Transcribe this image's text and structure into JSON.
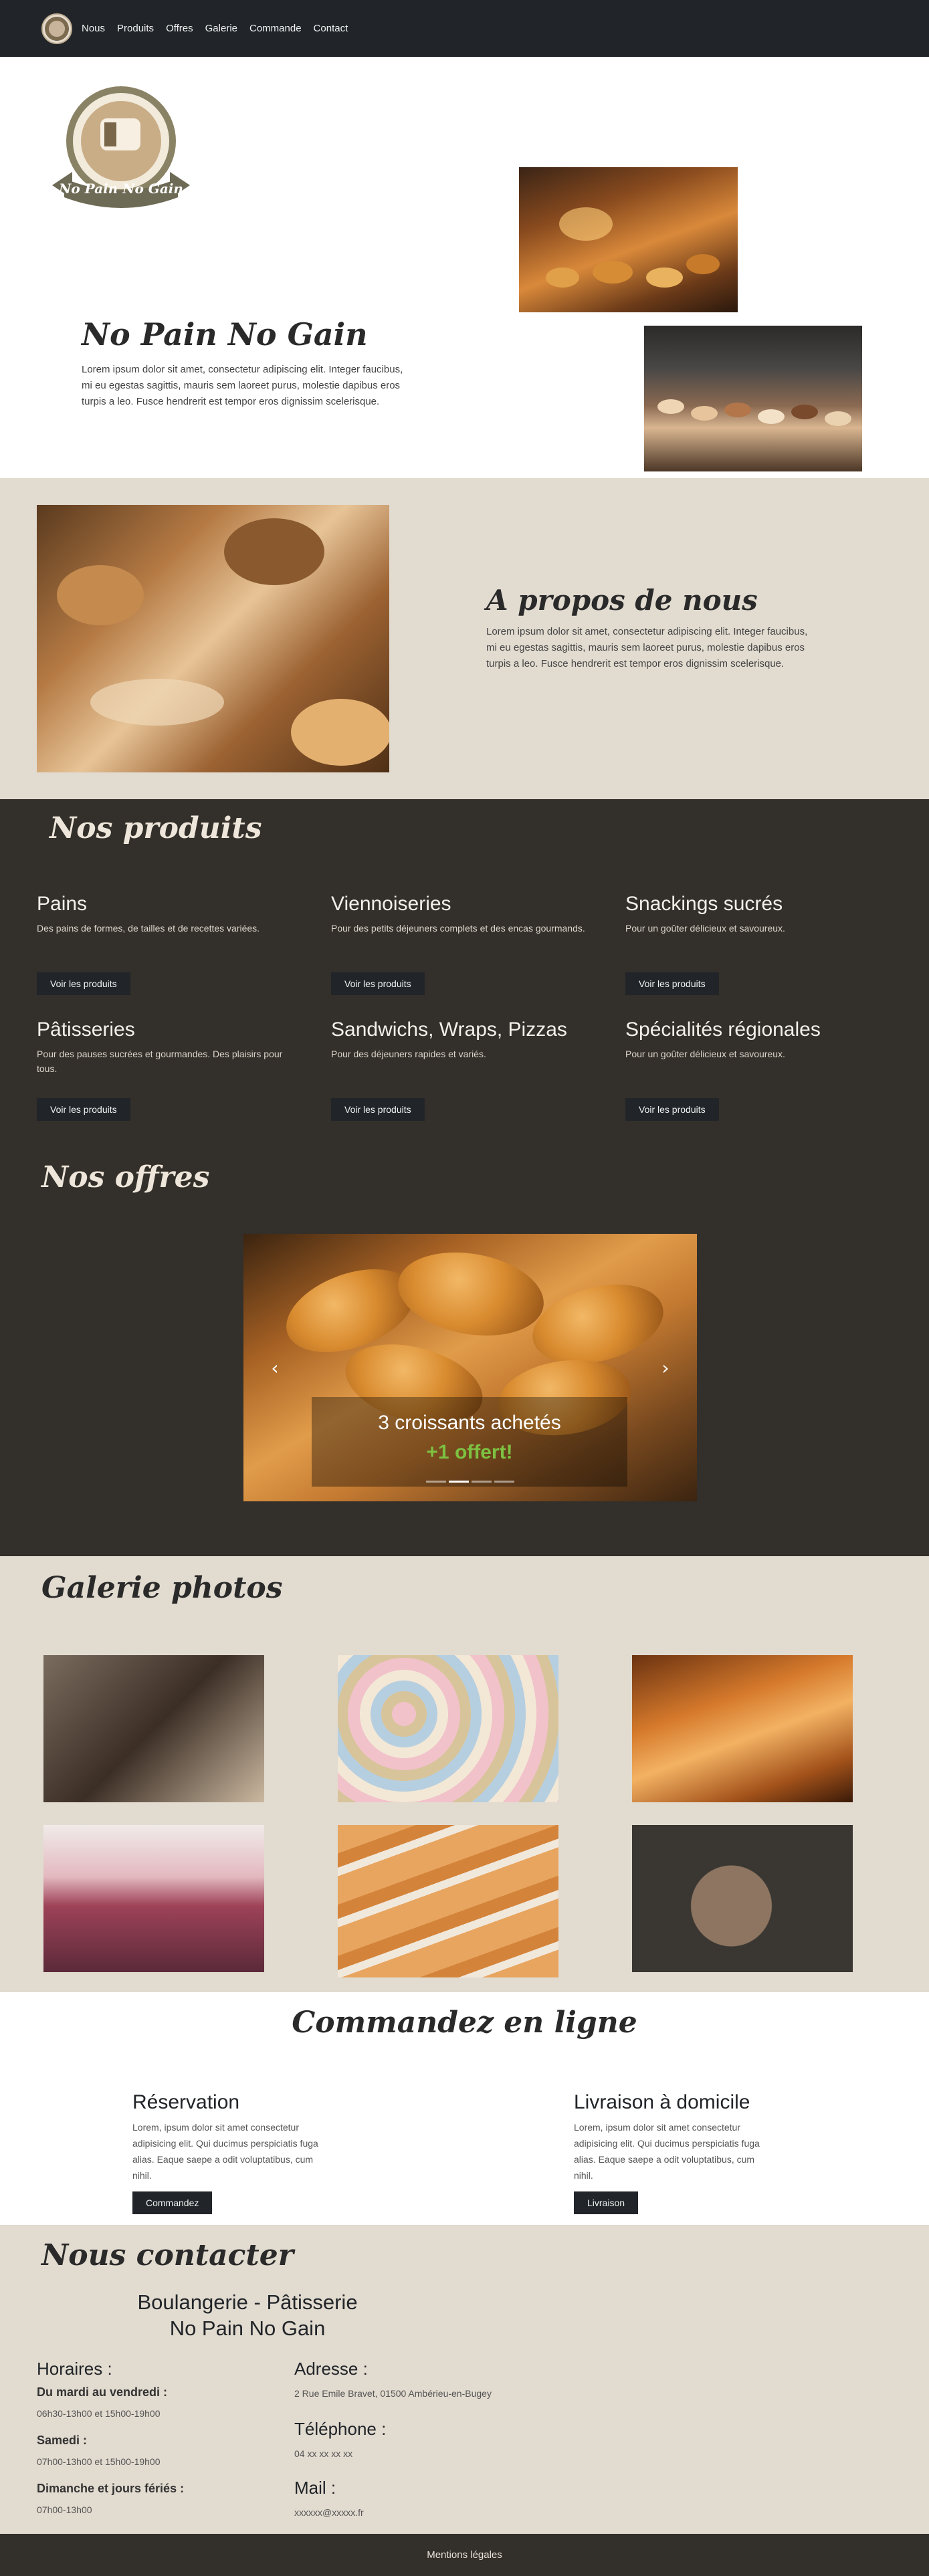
{
  "nav": {
    "logo_icon": "bakery-logo",
    "links": [
      "Nous",
      "Produits",
      "Offres",
      "Galerie",
      "Commande",
      "Contact"
    ]
  },
  "hero": {
    "logo_text": "No Pain No Gain",
    "title": "No Pain No Gain",
    "text": "Lorem ipsum dolor sit amet, consectetur adipiscing elit. Integer faucibus, mi eu egestas sagittis, mauris sem laoreet purus, molestie dapibus eros turpis a leo. Fusce hendrerit est tempor eros dignissim scelerisque."
  },
  "about": {
    "title": "A propos de nous",
    "text": "Lorem ipsum dolor sit amet, consectetur adipiscing elit. Integer faucibus, mi eu egestas sagittis, mauris sem laoreet purus, molestie dapibus eros turpis a leo. Fusce hendrerit est tempor eros dignissim scelerisque."
  },
  "products": {
    "title": "Nos produits",
    "button_label": "Voir les produits",
    "items": [
      {
        "name": "Pains",
        "desc": "Des pains de formes, de tailles et de recettes variées."
      },
      {
        "name": "Viennoiseries",
        "desc": "Pour des petits déjeuners complets et des encas gourmands."
      },
      {
        "name": "Snackings sucrés",
        "desc": "Pour un goûter délicieux et savoureux."
      },
      {
        "name": "Pâtisseries",
        "desc": "Pour des pauses sucrées et gourmandes. Des plaisirs pour tous."
      },
      {
        "name": "Sandwichs, Wraps, Pizzas",
        "desc": "Pour des déjeuners rapides et variés."
      },
      {
        "name": "Spécialités régionales",
        "desc": "Pour un goûter délicieux et savoureux."
      }
    ]
  },
  "offers": {
    "title": "Nos offres",
    "slide_line1": "3 croissants achetés",
    "slide_line2": "+1 offert!",
    "prev_icon": "chevron-left-icon",
    "next_icon": "chevron-right-icon",
    "slide_count": 4,
    "active_slide": 1
  },
  "gallery": {
    "title": "Galerie photos",
    "images": [
      "cookies",
      "macarons",
      "pains-au-chocolat",
      "cupcakes",
      "baguettes",
      "pains-complets"
    ]
  },
  "order": {
    "title": "Commandez en ligne",
    "columns": [
      {
        "title": "Réservation",
        "text": "Lorem, ipsum dolor sit amet consectetur adipisicing elit. Qui ducimus perspiciatis fuga alias. Eaque saepe a odit voluptatibus, cum nihil.",
        "button": "Commandez"
      },
      {
        "title": "Livraison à domicile",
        "text": "Lorem, ipsum dolor sit amet consectetur adipisicing elit. Qui ducimus perspiciatis fuga alias. Eaque saepe a odit voluptatibus, cum nihil.",
        "button": "Livraison"
      }
    ]
  },
  "contact": {
    "title": "Nous contacter",
    "name_line1": "Boulangerie - Pâtisserie",
    "name_line2": "No Pain No Gain",
    "hours_title": "Horaires :",
    "hours": [
      {
        "label": "Du mardi au vendredi :",
        "value": "06h30-13h00 et 15h00-19h00"
      },
      {
        "label": "Samedi :",
        "value": "07h00-13h00 et 15h00-19h00"
      },
      {
        "label": "Dimanche et jours fériés :",
        "value": "07h00-13h00"
      }
    ],
    "address_title": "Adresse :",
    "address": "2 Rue Emile Bravet, 01500 Ambérieu-en-Bugey",
    "phone_title": "Téléphone :",
    "phone": "04 xx xx xx xx",
    "mail_title": "Mail :",
    "mail": "xxxxxx@xxxxx.fr"
  },
  "footer": {
    "link": "Mentions légales"
  },
  "colors": {
    "navbar": "#212529",
    "beige": "#e2dbd0",
    "dark_section": "#332f2a",
    "offer_green": "#7dc142"
  }
}
